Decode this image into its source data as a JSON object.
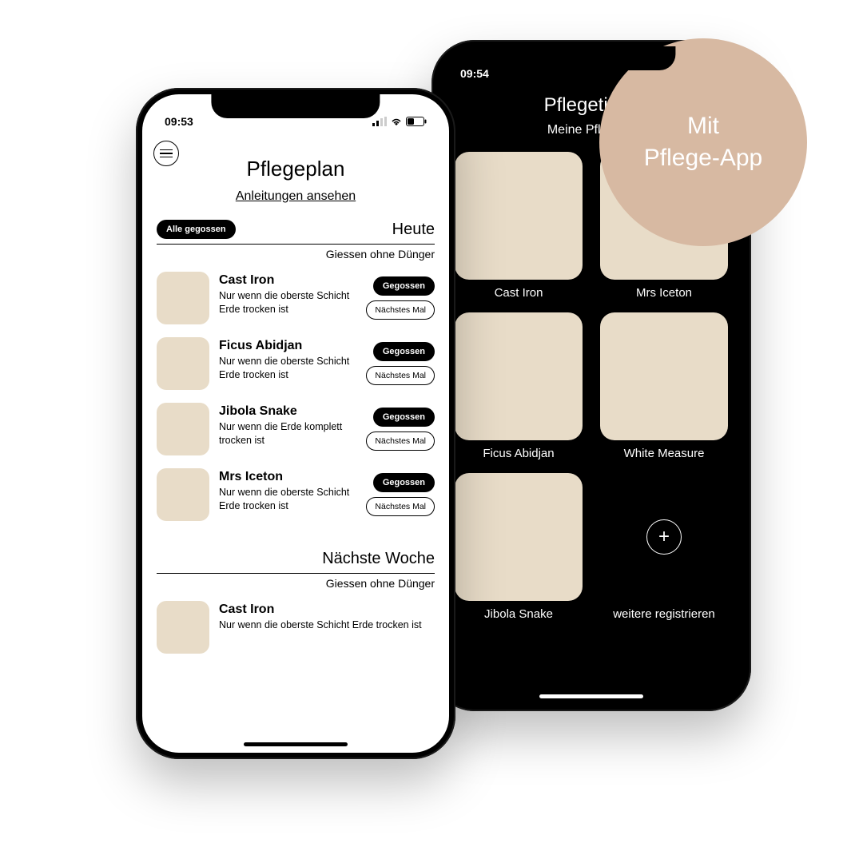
{
  "badge": {
    "line1": "Mit",
    "line2": "Pflege-App"
  },
  "phone2": {
    "statusTime": "09:54",
    "title": "Pflegetipps",
    "subtitle": "Meine Pflanzen",
    "tiles": [
      {
        "label": "Cast Iron"
      },
      {
        "label": "Mrs Iceton"
      },
      {
        "label": "Ficus Abidjan"
      },
      {
        "label": "White Measure"
      },
      {
        "label": "Jibola Snake"
      },
      {
        "label": "weitere registrieren"
      }
    ]
  },
  "phone1": {
    "statusTime": "09:53",
    "title": "Pflegeplan",
    "link": "Anleitungen ansehen",
    "allWatered": "Alle gegossen",
    "sectionToday": "Heute",
    "sectionNextWeek": "Nächste Woche",
    "note": "Giessen ohne Dünger",
    "wateredBtn": "Gegossen",
    "nextBtn": "Nächstes Mal",
    "plantsToday": [
      {
        "name": "Cast Iron",
        "desc": "Nur wenn die oberste Schicht Erde trocken ist"
      },
      {
        "name": "Ficus Abidjan",
        "desc": "Nur wenn die oberste Schicht Erde trocken ist"
      },
      {
        "name": "Jibola Snake",
        "desc": "Nur wenn die Erde komplett trocken ist"
      },
      {
        "name": "Mrs Iceton",
        "desc": "Nur wenn die oberste Schicht Erde trocken ist"
      }
    ],
    "plantsNext": [
      {
        "name": "Cast Iron",
        "desc": "Nur wenn die oberste Schicht Erde trocken ist"
      }
    ]
  }
}
